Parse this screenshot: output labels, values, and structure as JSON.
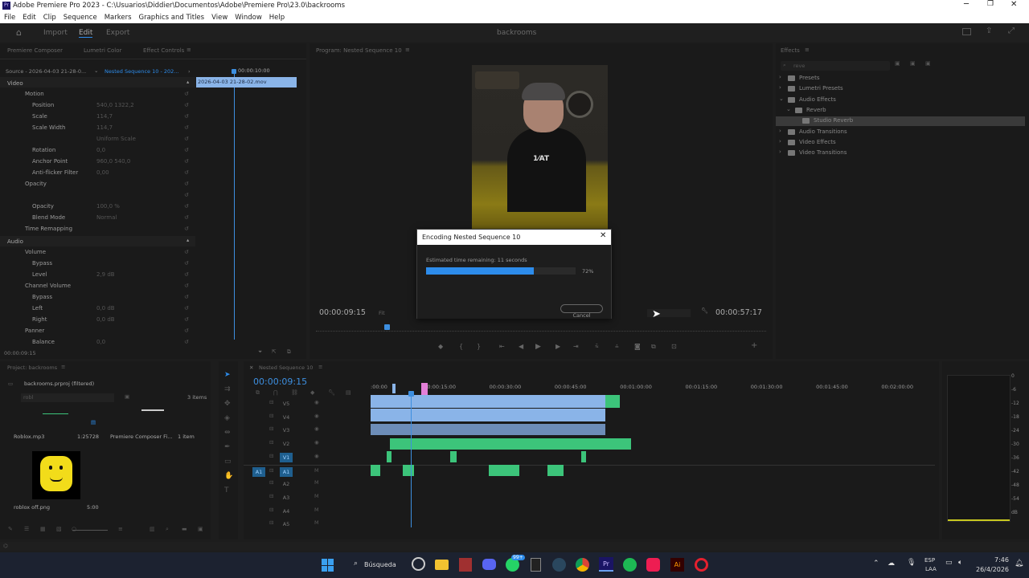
{
  "window": {
    "title": "Adobe Premiere Pro 2023 - C:\\Usuarios\\Diddier\\Documentos\\Adobe\\Premiere Pro\\23.0\\backrooms",
    "app_icon_text": "Pr"
  },
  "menu": [
    "File",
    "Edit",
    "Clip",
    "Sequence",
    "Markers",
    "Graphics and Titles",
    "View",
    "Window",
    "Help"
  ],
  "workspace": {
    "import": "Import",
    "edit": "Edit",
    "export": "Export",
    "project_name": "backrooms"
  },
  "effect_controls": {
    "tabs": [
      "Premiere Composer",
      "Lumetri Color",
      "Effect Controls"
    ],
    "source": "Source - 2026-04-03 21-28-0...",
    "target": "Nested Sequence 10 - 202...",
    "mini_timecode": "00:00:10:00",
    "clip_name": "2026-04-03 21-28-02.mov",
    "video_label": "Video",
    "audio_label": "Audio",
    "rows": [
      {
        "name": "Motion",
        "value": ""
      },
      {
        "name": "Position",
        "value": "540,0     1322,2"
      },
      {
        "name": "Scale",
        "value": "114,7"
      },
      {
        "name": "Scale Width",
        "value": "114,7"
      },
      {
        "name": "",
        "value": "Uniform Scale"
      },
      {
        "name": "Rotation",
        "value": "0,0"
      },
      {
        "name": "Anchor Point",
        "value": "960,0     540,0"
      },
      {
        "name": "Anti-flicker Filter",
        "value": "0,00"
      },
      {
        "name": "Opacity",
        "value": ""
      },
      {
        "name": "",
        "value": ""
      },
      {
        "name": "Opacity",
        "value": "100,0 %"
      },
      {
        "name": "Blend Mode",
        "value": "Normal"
      },
      {
        "name": "Time Remapping",
        "value": ""
      }
    ],
    "audio_rows": [
      {
        "name": "Volume",
        "value": ""
      },
      {
        "name": "Bypass",
        "value": ""
      },
      {
        "name": "Level",
        "value": "2,9 dB"
      },
      {
        "name": "Channel Volume",
        "value": ""
      },
      {
        "name": "Bypass",
        "value": ""
      },
      {
        "name": "Left",
        "value": "0,0 dB"
      },
      {
        "name": "Right",
        "value": "0,0 dB"
      },
      {
        "name": "Panner",
        "value": ""
      },
      {
        "name": "Balance",
        "value": "0,0"
      }
    ],
    "footer_timecode": "00:00:09:15"
  },
  "program": {
    "title": "Program: Nested Sequence 10",
    "timecode_left": "00:00:09:15",
    "fit_label": "Fit",
    "timecode_right": "00:00:57:17",
    "shirt_text": "1⁄AT"
  },
  "dialog": {
    "title": "Encoding Nested Sequence 10",
    "status": "Estimated time remaining: 11 seconds",
    "percent_label": "72%",
    "progress": 0.72,
    "cancel": "Cancel"
  },
  "effects": {
    "title": "Effects",
    "search": "reve",
    "tree": [
      {
        "label": "Presets",
        "depth": 0,
        "open": false
      },
      {
        "label": "Lumetri Presets",
        "depth": 0,
        "open": false
      },
      {
        "label": "Audio Effects",
        "depth": 0,
        "open": true
      },
      {
        "label": "Reverb",
        "depth": 1,
        "open": true
      },
      {
        "label": "Studio Reverb",
        "depth": 2,
        "selected": true
      },
      {
        "label": "Audio Transitions",
        "depth": 0,
        "open": false
      },
      {
        "label": "Video Effects",
        "depth": 0,
        "open": false
      },
      {
        "label": "Video Transitions",
        "depth": 0,
        "open": false
      }
    ]
  },
  "project": {
    "title": "Project: backrooms",
    "file": "backrooms.prproj (filtered)",
    "search": "robl",
    "count": "3 items",
    "items": [
      {
        "name": "Roblox.mp3",
        "meta": "1:25728"
      },
      {
        "name": "Premiere Composer Fi...",
        "meta": "1 item"
      },
      {
        "name": "roblox off.png",
        "meta": "5:00"
      }
    ]
  },
  "timeline": {
    "title": "Nested Sequence 10",
    "timecode": "00:00:09:15",
    "ruler": [
      ":00:00",
      "00:00:15:00",
      "00:00:30:00",
      "00:00:45:00",
      "00:01:00:00",
      "00:01:15:00",
      "00:01:30:00",
      "00:01:45:00",
      "00:02:00:00"
    ],
    "video_tracks": [
      "V5",
      "V4",
      "V3",
      "V2",
      "V1"
    ],
    "audio_tracks": [
      "A1",
      "A2",
      "A3",
      "A4",
      "A5"
    ],
    "source_patch_a": "A1"
  },
  "meter": {
    "ticks": [
      "0",
      "-6",
      "-12",
      "-18",
      "-24",
      "-30",
      "-36",
      "-42",
      "-48",
      "-54",
      "dB"
    ]
  },
  "taskbar": {
    "search": "Búsqueda",
    "badge": "99+",
    "lang": "ESP",
    "lang2": "LAA",
    "time": "7:46",
    "date": "26/4/2026"
  },
  "colors": {
    "accent": "#2d8ceb",
    "clip_video": "#8ab4e8",
    "clip_audio": "#3cc47a",
    "playhead": "#3d8fe0",
    "pink": "#e37fd8"
  }
}
